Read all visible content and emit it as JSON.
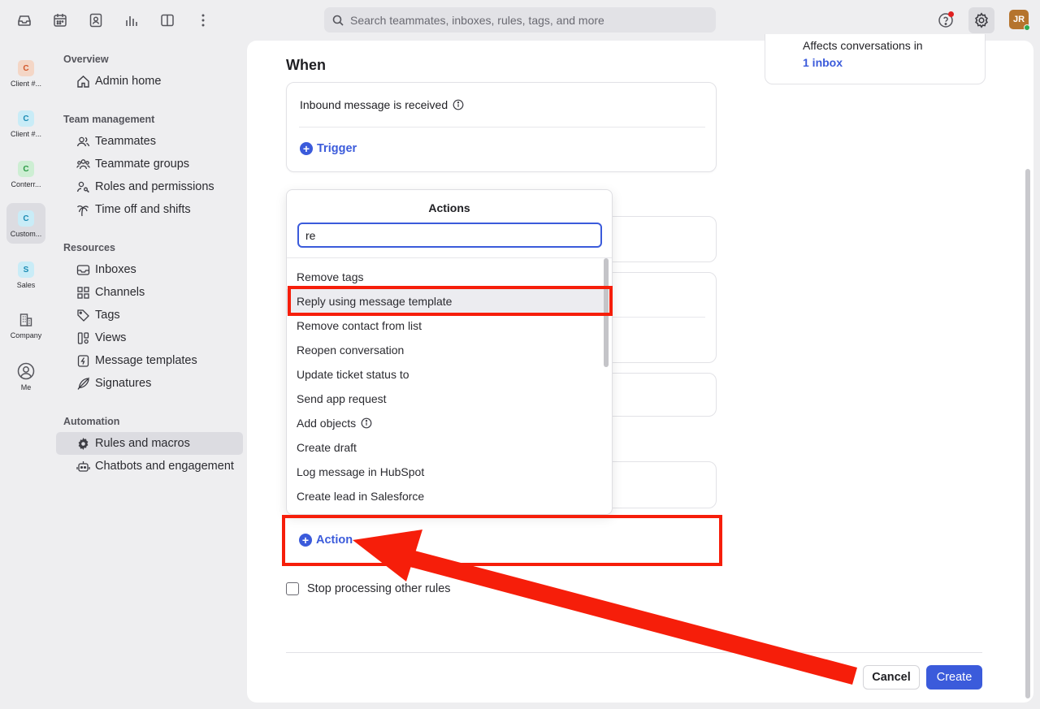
{
  "topbar": {
    "search_placeholder": "Search teammates, inboxes, rules, tags, and more",
    "avatar_initials": "JR",
    "icons": [
      "inbox-icon",
      "calendar-icon",
      "contacts-icon",
      "analytics-icon",
      "split-view-icon",
      "more-vertical-icon",
      "help-icon",
      "settings-gear-icon"
    ]
  },
  "rail": {
    "items": [
      {
        "badge": "C",
        "label": "Client #...",
        "badge_color": "#f4d6c6",
        "text_color": "#d2562a"
      },
      {
        "badge": "C",
        "label": "Client #...",
        "badge_color": "#c9ecf7",
        "text_color": "#1b8bb3"
      },
      {
        "badge": "C",
        "label": "Conterr...",
        "badge_color": "#cdeed3",
        "text_color": "#2b9a45"
      },
      {
        "badge": "C",
        "label": "Custom...",
        "badge_color": "#c9ecf7",
        "text_color": "#1b8bb3"
      },
      {
        "badge": "S",
        "label": "Sales",
        "badge_color": "#c9ecf7",
        "text_color": "#1b8bb3"
      }
    ],
    "company_label": "Company",
    "me_label": "Me"
  },
  "nav": {
    "overview": "Overview",
    "admin_home": "Admin home",
    "team_management": "Team management",
    "teammates": "Teammates",
    "teammate_groups": "Teammate groups",
    "roles": "Roles and permissions",
    "time_off": "Time off and shifts",
    "resources": "Resources",
    "inboxes": "Inboxes",
    "channels": "Channels",
    "tags": "Tags",
    "views": "Views",
    "message_templates": "Message templates",
    "signatures": "Signatures",
    "automation": "Automation",
    "rules_macros": "Rules and macros",
    "chatbots": "Chatbots and engagement"
  },
  "main": {
    "when_heading": "When",
    "trigger_text": "Inbound message is received",
    "trigger_button": "Trigger",
    "affects_title": "Affects conversations in",
    "affects_link": "1 inbox",
    "action_button": "Action",
    "stop_processing": "Stop processing other rules",
    "cancel": "Cancel",
    "create": "Create"
  },
  "dropdown": {
    "title": "Actions",
    "query": "re",
    "items": [
      "Remove tags",
      "Reply using message template",
      "Remove contact from list",
      "Reopen conversation",
      "Update ticket status to",
      "Send app request",
      "Add objects",
      "Create draft",
      "Log message in HubSpot",
      "Create lead in Salesforce"
    ],
    "highlighted_index": 1
  },
  "colors": {
    "accent": "#3b5bdb",
    "annotation": "#f61e0a"
  }
}
